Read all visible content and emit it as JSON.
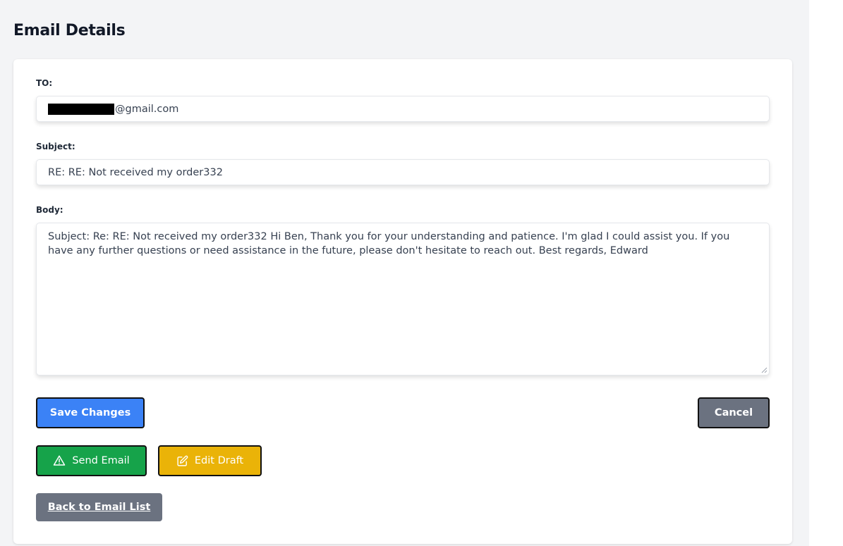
{
  "page": {
    "title": "Email Details"
  },
  "form": {
    "to_label": "TO:",
    "to_value_visible": "@gmail.com",
    "subject_label": "Subject:",
    "subject_value": "RE: RE: Not received my order332",
    "body_label": "Body:",
    "body_value": "Subject: Re: RE: Not received my order332 Hi Ben, Thank you for your understanding and patience. I'm glad I could assist you. If you have any further questions or need assistance in the future, please don't hesitate to reach out. Best regards, Edward"
  },
  "actions": {
    "save_label": "Save Changes",
    "cancel_label": "Cancel",
    "send_label": "Send Email",
    "edit_label": "Edit Draft",
    "back_label": "Back to Email List"
  },
  "icons": {
    "send": "warning-triangle-icon",
    "edit": "edit-square-icon"
  },
  "colors": {
    "save": "#3b82f6",
    "cancel": "#6b7280",
    "send": "#16a34a",
    "edit": "#eab308",
    "back": "#6b7280"
  }
}
